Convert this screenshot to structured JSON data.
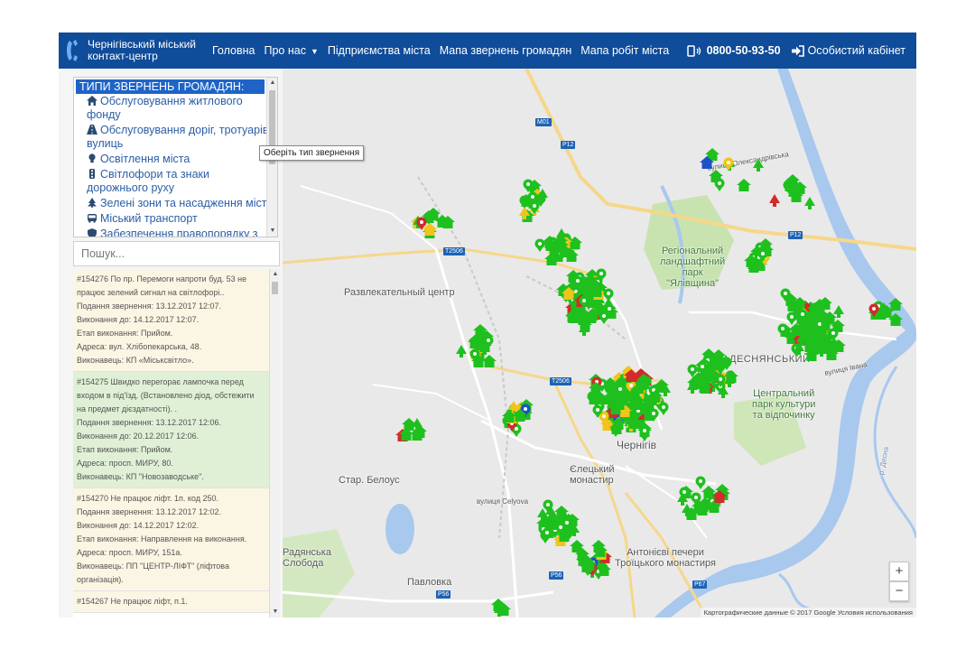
{
  "navbar": {
    "brand_line1": "Чернігівський міський",
    "brand_line2": "контакт-центр",
    "items": [
      {
        "label": "Головна"
      },
      {
        "label": "Про нас"
      },
      {
        "label": "Підприємства міста"
      },
      {
        "label": "Мапа звернень громадян"
      },
      {
        "label": "Мапа робіт міста"
      }
    ],
    "phone": "0800-50-93-50",
    "cabinet": "Особистий кабінет"
  },
  "sidebar": {
    "category_header": "ТИПИ ЗВЕРНЕНЬ ГРОМАДЯН:",
    "categories": [
      {
        "label": "Обслуговування житлового фонду",
        "icon": "home-icon"
      },
      {
        "label": "Обслуговування доріг, тротуарів, вулиць",
        "icon": "road-icon"
      },
      {
        "label": "Освітлення міста",
        "icon": "bulb-icon"
      },
      {
        "label": "Світлофори та знаки дорожнього руху",
        "icon": "traffic-light-icon"
      },
      {
        "label": "Зелені зони та насадження міста",
        "icon": "tree-icon"
      },
      {
        "label": "Міський транспорт",
        "icon": "bus-icon"
      },
      {
        "label": "Забезпечення правопорядку з",
        "icon": "shield-icon"
      }
    ],
    "tooltip": "Оберіть тип звернення",
    "search_placeholder": "Пошук...",
    "tickets": [
      {
        "status": "yellow",
        "lines": [
          "#154276 По пр. Перемоги напроти буд. 53 не працює зелений сигнал на світлофорі..",
          "Подання звернення: 13.12.2017 12:07.",
          "Виконання до: 14.12.2017 12:07.",
          "Етап виконання: Прийом.",
          "Адреса: вул. Хлібопекарська, 48.",
          "Виконавець: КП «Міськсвітло»."
        ]
      },
      {
        "status": "green",
        "lines": [
          "#154275 Швидко перегорає лампочка перед входом в під'їзд. (Встановлено діод, обстежити на предмет дієздатності). .",
          "Подання звернення: 13.12.2017 12:06.",
          "Виконання до: 20.12.2017 12:06.",
          "Етап виконання: Прийом.",
          "Адреса: просп. МИРУ, 80.",
          "Виконавець: КП \"Новозаводське\"."
        ]
      },
      {
        "status": "yellow",
        "lines": [
          "#154270 Не працює ліфт. 1п. код 250.",
          "Подання звернення: 13.12.2017 12:02.",
          "Виконання до: 14.12.2017 12:02.",
          "Етап виконання: Направлення на виконання.",
          "Адреса: просп. МИРУ, 151а.",
          "Виконавець: ПП \"ЦЕНТР-ЛІФТ\" (ліфтова організація)."
        ]
      },
      {
        "status": "yellow",
        "lines": [
          "#154267 Не працює ліфт, п.1."
        ]
      }
    ],
    "google_letter": "G"
  },
  "map": {
    "labels": {
      "park": "Регіональний\nландшафтний\nпарк\n\"Ялівщина\"",
      "mall": "Развлекательный центр",
      "desnyanskyi": "ДЕСНЯНСЬКИЙ",
      "culture_park": "Центральний\nпарк культури\nта відпочинку",
      "chernihiv": "Чернігів",
      "old_belous": "Стар. Белоус",
      "radyanska": "Радянська\nСлобода",
      "pavlovka": "Павловка",
      "monastery": "Антонієві печери\nТроїцького монастиря",
      "eletsky": "Єлецький\nмонастир",
      "street1": "вулиця Олександрівська",
      "street2": "вулиця Івана",
      "street3": "вулиця Celyova",
      "desna": "р. Десна"
    },
    "shields": [
      "M01",
      "P12",
      "T2506",
      "T2506",
      "P56",
      "P56",
      "P67",
      "P12"
    ],
    "zoom_in": "+",
    "zoom_out": "−",
    "attribution": "Картографические данные © 2017 Google    Условия использования"
  },
  "colors": {
    "nav": "#0f4c99",
    "marker_green": "#1ec01e",
    "marker_red": "#d42a2a",
    "marker_yellow": "#f0c419",
    "marker_blue": "#1e50c8"
  }
}
